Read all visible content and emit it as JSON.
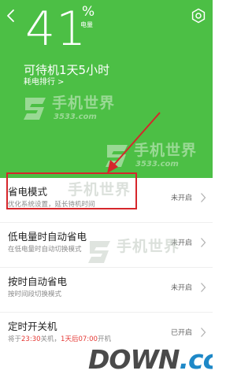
{
  "header": {
    "battery_percent": "41",
    "battery_unit": "%",
    "battery_caption": "电量",
    "standby_text": "可待机1天5小时",
    "ranking_label": "耗电排行",
    "ranking_chevron": ">",
    "bg_color": "#4cbf45"
  },
  "watermark": {
    "title": "手机世界",
    "sub": "3533.com"
  },
  "list": {
    "items": [
      {
        "title": "省电模式",
        "desc": "优化系统设置，延长待机时间",
        "status": "未开启"
      },
      {
        "title": "低电量时自动省电",
        "desc": "在低电量时自动切换模式",
        "status": "未开启"
      },
      {
        "title": "按时自动省电",
        "desc": "按时间段切换模式",
        "status": "未开启"
      },
      {
        "title": "定时开关机",
        "desc_prefix": "将于",
        "desc_time1": "23:30",
        "desc_mid": "关机，",
        "desc_day": "1天后",
        "desc_time2": "07:00",
        "desc_suffix": "开机",
        "status": "已开启"
      }
    ]
  },
  "logo": {
    "word": "DOWN",
    "suffix": ".cc"
  },
  "colors": {
    "highlight": "#d6262b",
    "accent_red": "#e53935"
  }
}
